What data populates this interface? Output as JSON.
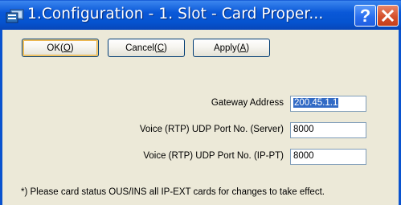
{
  "window": {
    "title": "1.Configuration - 1. Slot - Card Proper...",
    "icon": "app-window-icon",
    "help_icon": "help-icon",
    "close_icon": "close-icon",
    "help_glyph": "?"
  },
  "buttons": {
    "ok": {
      "label_prefix": "OK(",
      "accel": "O",
      "label_suffix": ")"
    },
    "cancel": {
      "label_prefix": "Cancel(",
      "accel": "C",
      "label_suffix": ")"
    },
    "apply": {
      "label_prefix": "Apply(",
      "accel": "A",
      "label_suffix": ")"
    }
  },
  "fields": [
    {
      "label": "Gateway Address",
      "value": "200.45.1.1"
    },
    {
      "label": "Voice (RTP) UDP Port No. (Server)",
      "value": "8000"
    },
    {
      "label": "Voice (RTP) UDP Port No. (IP-PT)",
      "value": "8000"
    }
  ],
  "note": "*) Please card status OUS/INS all IP-EXT cards for changes to take effect.",
  "colors": {
    "titlebar": "#0553cf",
    "client_bg": "#ece9d8",
    "selection": "#316ac5",
    "close_button": "#d5502d"
  }
}
